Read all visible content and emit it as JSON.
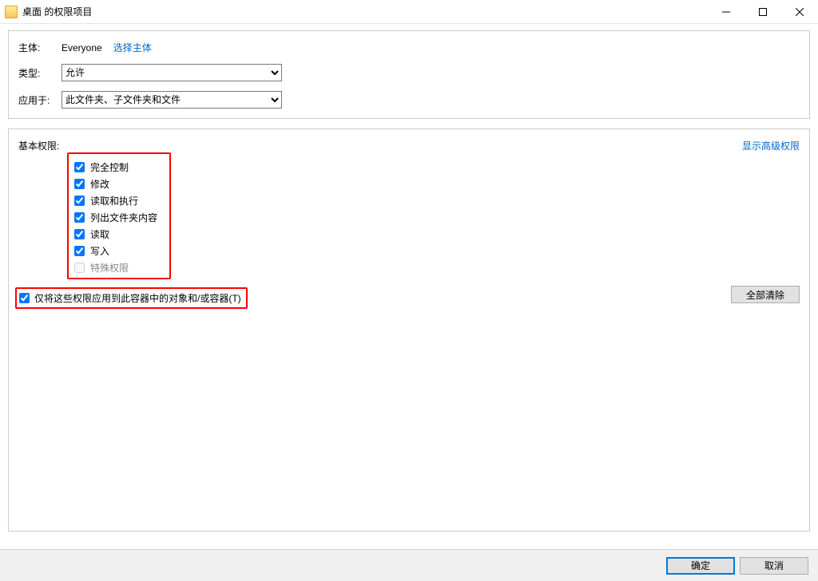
{
  "window": {
    "title": "桌面 的权限项目"
  },
  "top": {
    "principal_label": "主体:",
    "principal_name": "Everyone",
    "select_principal": "选择主体",
    "type_label": "类型:",
    "type_value": "允许",
    "applyto_label": "应用于:",
    "applyto_value": "此文件夹、子文件夹和文件"
  },
  "perm": {
    "header": "基本权限:",
    "show_advanced": "显示高级权限",
    "items": [
      {
        "label": "完全控制",
        "checked": true,
        "enabled": true
      },
      {
        "label": "修改",
        "checked": true,
        "enabled": true
      },
      {
        "label": "读取和执行",
        "checked": true,
        "enabled": true
      },
      {
        "label": "列出文件夹内容",
        "checked": true,
        "enabled": true
      },
      {
        "label": "读取",
        "checked": true,
        "enabled": true
      },
      {
        "label": "写入",
        "checked": true,
        "enabled": true
      },
      {
        "label": "特殊权限",
        "checked": false,
        "enabled": false
      }
    ],
    "apply_only": "仅将这些权限应用到此容器中的对象和/或容器(T)",
    "apply_only_checked": true,
    "clear_all": "全部清除"
  },
  "footer": {
    "ok": "确定",
    "cancel": "取消"
  }
}
